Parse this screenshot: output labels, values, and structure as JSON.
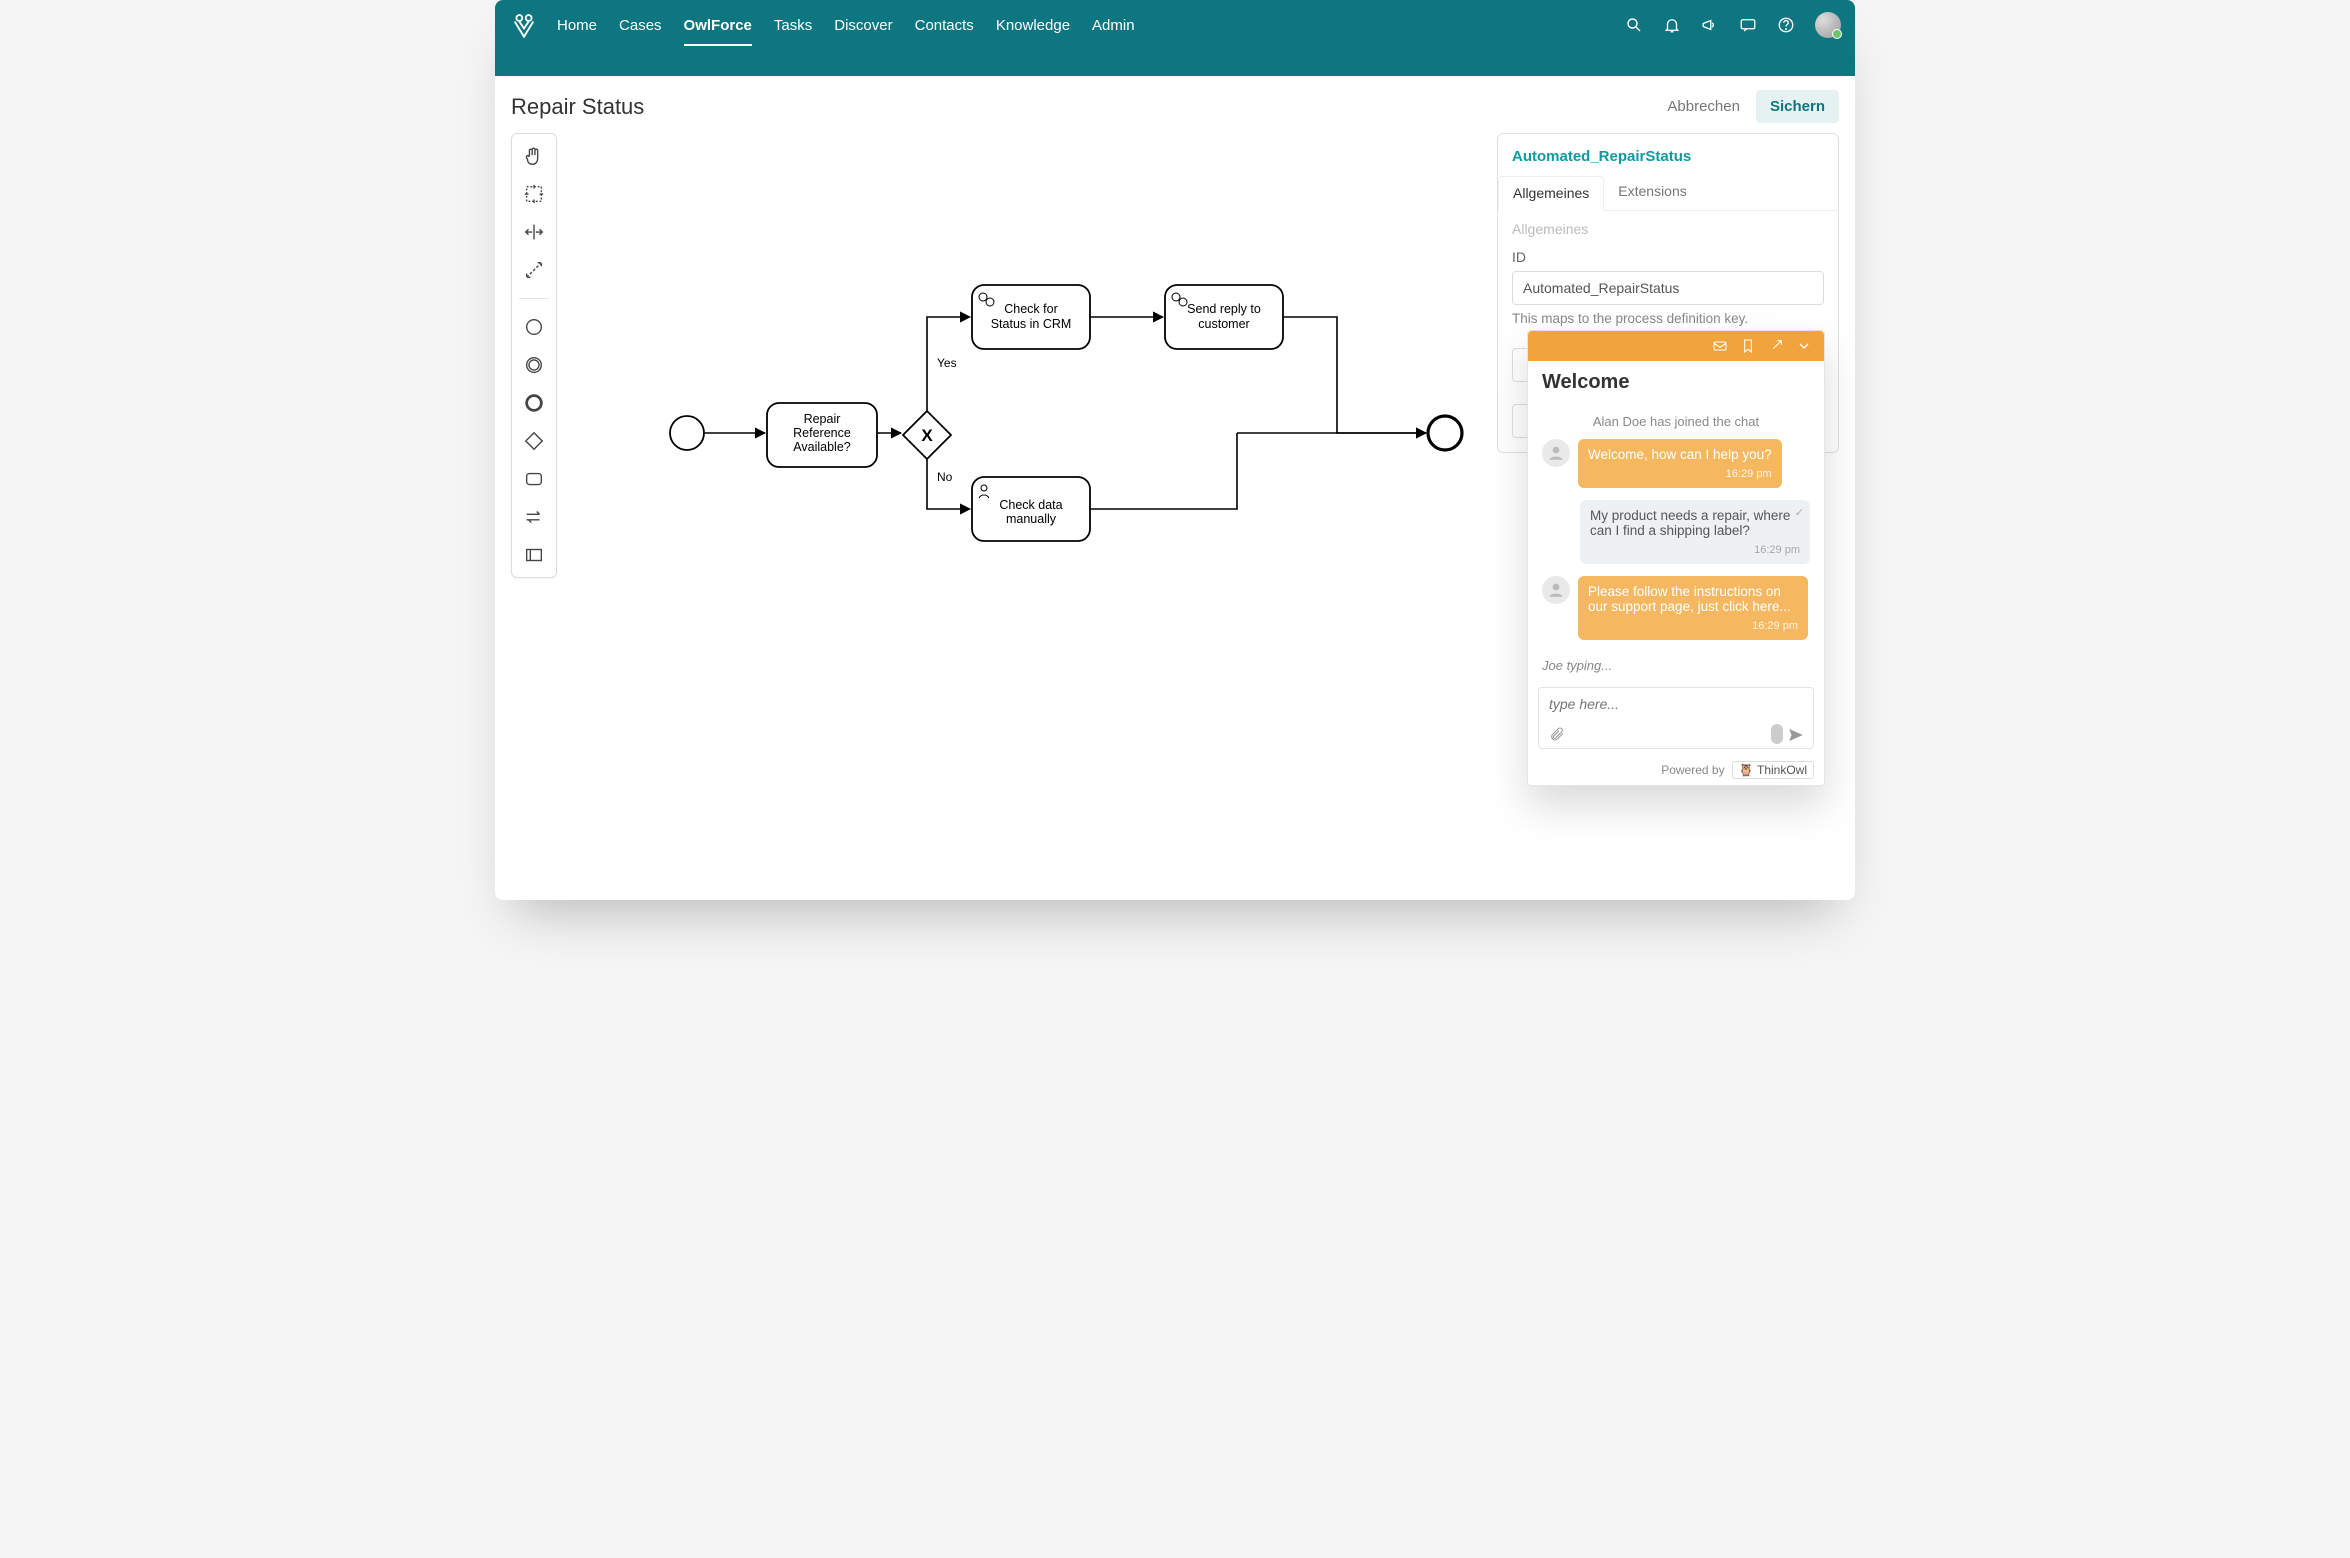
{
  "nav": {
    "active": "OwlForce",
    "items": [
      "Home",
      "Cases",
      "OwlForce",
      "Tasks",
      "Discover",
      "Contacts",
      "Knowledge",
      "Admin"
    ]
  },
  "page": {
    "title": "Repair Status",
    "cancel_label": "Abbrechen",
    "save_label": "Sichern"
  },
  "diagram": {
    "task1": "Repair\nReference\nAvailable?",
    "gateway_yes": "Yes",
    "gateway_no": "No",
    "task_crm": "Check for\nStatus in CRM",
    "task_reply": "Send reply to\ncustomer",
    "task_manual": "Check data\nmanually"
  },
  "props": {
    "title": "Automated_RepairStatus",
    "tab1": "Allgemeines",
    "tab2": "Extensions",
    "section": "Allgemeines",
    "id_label": "ID",
    "id_value": "Automated_RepairStatus",
    "hint": "This maps to the process definition key."
  },
  "chat": {
    "title": "Welcome",
    "system": "Alan Doe has joined the chat",
    "m1_text": "Welcome, how can I help you?",
    "m1_time": "16:29 pm",
    "m2_text": "My product needs a repair, where can I find a shipping label?",
    "m2_time": "16:29 pm",
    "m3_text": "Please follow the instructions on our support page, just click here...",
    "m3_time": "16:29 pm",
    "typing": "Joe typing...",
    "input_placeholder": "type here...",
    "powered_by": "Powered by",
    "brand": "ThinkOwl"
  }
}
